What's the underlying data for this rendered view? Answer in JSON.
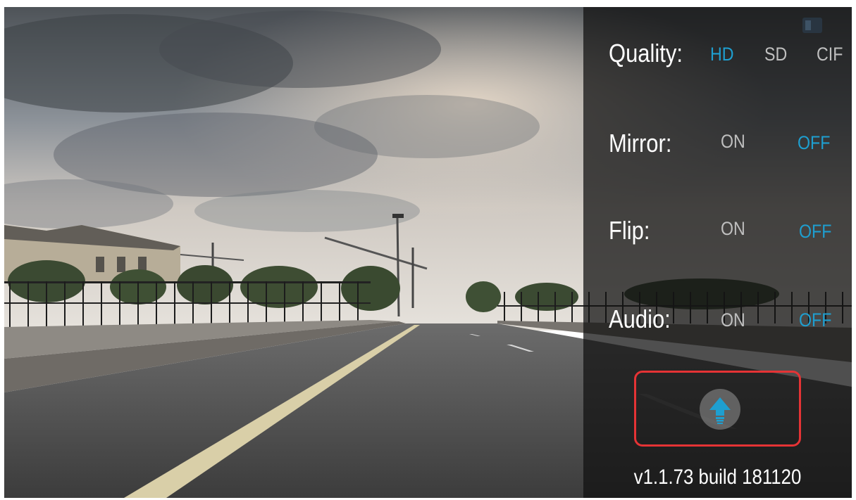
{
  "settings": {
    "quality": {
      "label": "Quality:",
      "options": [
        "HD",
        "SD",
        "CIF"
      ],
      "selected": "HD"
    },
    "mirror": {
      "label": "Mirror:",
      "on": "ON",
      "off": "OFF",
      "selected": "OFF"
    },
    "flip": {
      "label": "Flip:",
      "on": "ON",
      "off": "OFF",
      "selected": "OFF"
    },
    "audio": {
      "label": "Audio:",
      "on": "ON",
      "off": "OFF",
      "selected": "OFF"
    }
  },
  "upgrade": {
    "icon": "upload-arrow-icon"
  },
  "version": "v1.1.73 build 181120",
  "colors": {
    "accent": "#1e9fd0",
    "inactive": "#bfbfbf",
    "highlight": "#e53335"
  }
}
